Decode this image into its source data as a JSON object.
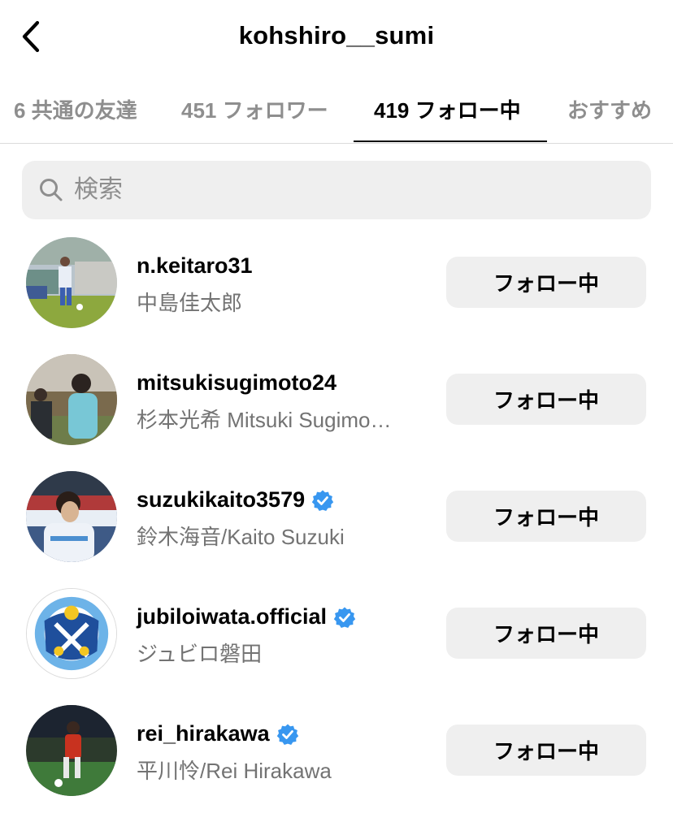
{
  "header": {
    "title": "kohshiro__sumi"
  },
  "tabs": [
    {
      "label": "6 共通の友達"
    },
    {
      "label": "451 フォロワー"
    },
    {
      "label": "419 フォロー中"
    },
    {
      "label": "おすすめ"
    }
  ],
  "search": {
    "placeholder": "検索"
  },
  "accounts": [
    {
      "username": "n.keitaro31",
      "fullname": "中島佳太郎",
      "verified": false,
      "button": "フォロー中"
    },
    {
      "username": "mitsukisugimoto24",
      "fullname": "杉本光希 Mitsuki Sugimo…",
      "verified": false,
      "button": "フォロー中"
    },
    {
      "username": "suzukikaito3579",
      "fullname": "鈴木海音/Kaito Suzuki",
      "verified": true,
      "button": "フォロー中"
    },
    {
      "username": "jubiloiwata.official",
      "fullname": "ジュビロ磐田",
      "verified": true,
      "button": "フォロー中"
    },
    {
      "username": "rei_hirakawa",
      "fullname": "平川怜/Rei Hirakawa",
      "verified": true,
      "button": "フォロー中"
    }
  ],
  "colors": {
    "verified": "#3897f0",
    "secondary_text": "#737373",
    "button_bg": "#efefef",
    "search_bg": "#efefef"
  }
}
